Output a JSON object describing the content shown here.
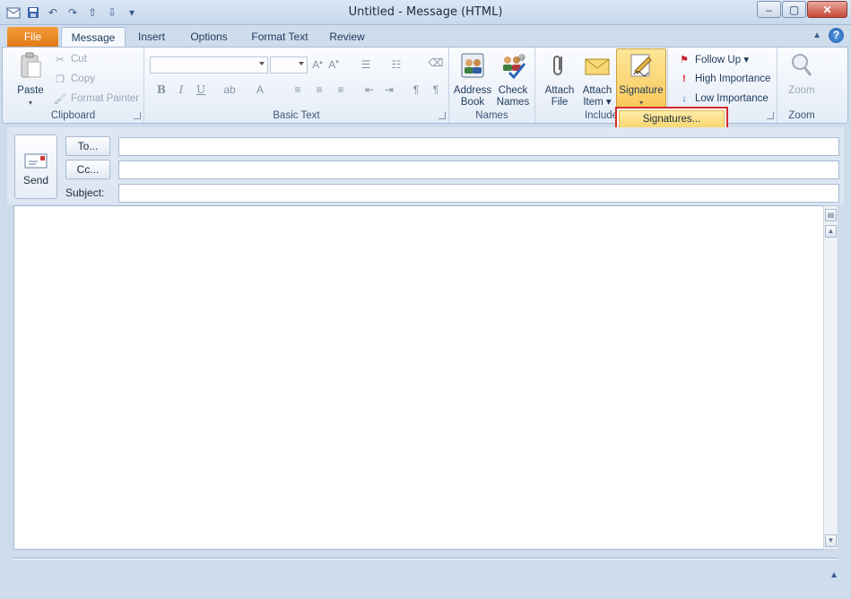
{
  "window": {
    "title": "Untitled - Message (HTML)",
    "controls": {
      "minimize": "–",
      "maximize": "▢",
      "close": "✕"
    }
  },
  "qat": {
    "icons": [
      "outlook-app-icon",
      "save-icon",
      "undo-icon",
      "redo-icon",
      "up-arrow-icon",
      "down-arrow-icon",
      "qat-customize-icon"
    ]
  },
  "tabs": {
    "file": "File",
    "items": [
      "Message",
      "Insert",
      "Options",
      "Format Text",
      "Review"
    ],
    "active": "Message"
  },
  "ribbon": {
    "clipboard": {
      "label": "Clipboard",
      "paste": "Paste",
      "cut": "Cut",
      "copy": "Copy",
      "format_painter": "Format Painter"
    },
    "basic_text": {
      "label": "Basic Text"
    },
    "names": {
      "label": "Names",
      "address_book": [
        "Address",
        "Book"
      ],
      "check_names": [
        "Check",
        "Names"
      ]
    },
    "include": {
      "label": "Include",
      "attach_file": [
        "Attach",
        "File"
      ],
      "attach_item": [
        "Attach",
        "Item ▾"
      ],
      "signature": "Signature"
    },
    "tags": {
      "follow_up": "Follow Up ▾",
      "high_importance": "High Importance",
      "low_importance": "Low Importance"
    },
    "zoom": {
      "label": "Zoom",
      "button": "Zoom"
    }
  },
  "signature_menu": {
    "item": "Signatures..."
  },
  "header": {
    "send": "Send",
    "to": "To...",
    "cc": "Cc...",
    "subject": "Subject:",
    "to_value": "",
    "cc_value": "",
    "subject_value": ""
  },
  "body": {
    "text": ""
  },
  "colors": {
    "file_tab": "#e07a16",
    "highlight": "#f9c95b",
    "menu_border": "#d12a2a"
  }
}
